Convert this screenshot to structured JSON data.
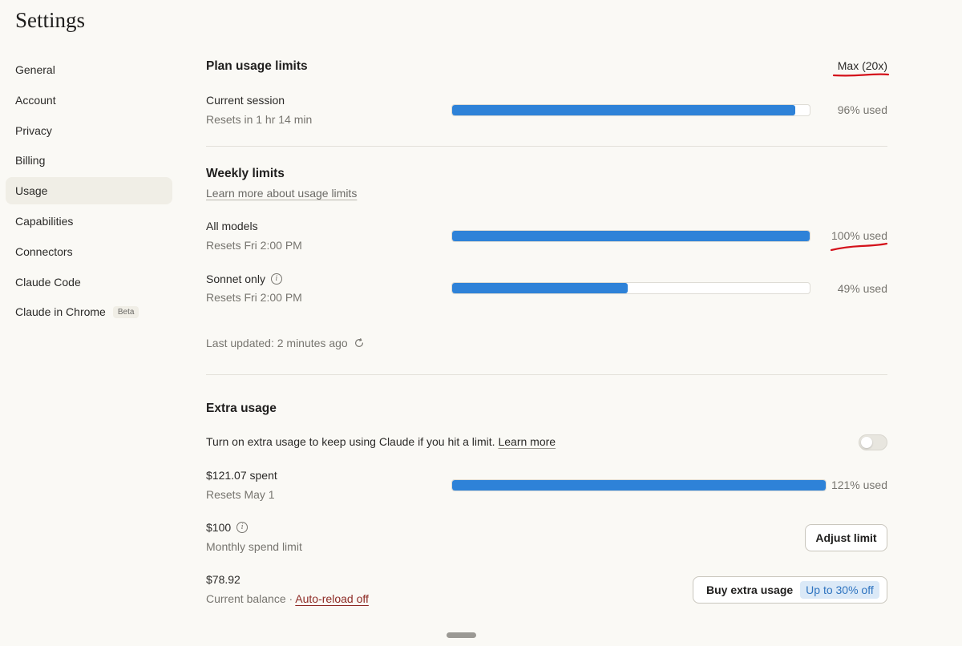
{
  "page": {
    "title": "Settings"
  },
  "sidebar": {
    "items": [
      {
        "label": "General"
      },
      {
        "label": "Account"
      },
      {
        "label": "Privacy"
      },
      {
        "label": "Billing"
      },
      {
        "label": "Usage",
        "active": true
      },
      {
        "label": "Capabilities"
      },
      {
        "label": "Connectors"
      },
      {
        "label": "Claude Code"
      },
      {
        "label": "Claude in Chrome",
        "badge": "Beta"
      }
    ]
  },
  "plan": {
    "heading": "Plan usage limits",
    "plan_name": "Max (20x)",
    "current_session": {
      "label": "Current session",
      "sub": "Resets in 1 hr 14 min",
      "percent": 96,
      "percent_text": "96% used"
    }
  },
  "weekly": {
    "heading": "Weekly limits",
    "learn_more": "Learn more about usage limits",
    "all_models": {
      "label": "All models",
      "sub": "Resets Fri 2:00 PM",
      "percent": 100,
      "percent_text": "100% used"
    },
    "sonnet": {
      "label": "Sonnet only",
      "sub": "Resets Fri 2:00 PM",
      "percent": 49,
      "percent_text": "49% used"
    },
    "last_updated": "Last updated: 2 minutes ago"
  },
  "extra": {
    "heading": "Extra usage",
    "description": "Turn on extra usage to keep using Claude if you hit a limit.",
    "learn_more": "Learn more",
    "toggle_on": false,
    "spent": {
      "label": "$121.07 spent",
      "sub": "Resets May 1",
      "percent": 121,
      "percent_text": "121% used"
    },
    "limit": {
      "label": "$100",
      "sub": "Monthly spend limit",
      "button": "Adjust limit"
    },
    "balance": {
      "label": "$78.92",
      "sub": "Current balance",
      "separator": " · ",
      "auto_reload": "Auto-reload off",
      "button": "Buy extra usage",
      "discount": "Up to 30% off"
    }
  },
  "colors": {
    "accent_bar": "#2e82d8",
    "annotation_red": "#d4121b",
    "background": "#faf9f5"
  }
}
